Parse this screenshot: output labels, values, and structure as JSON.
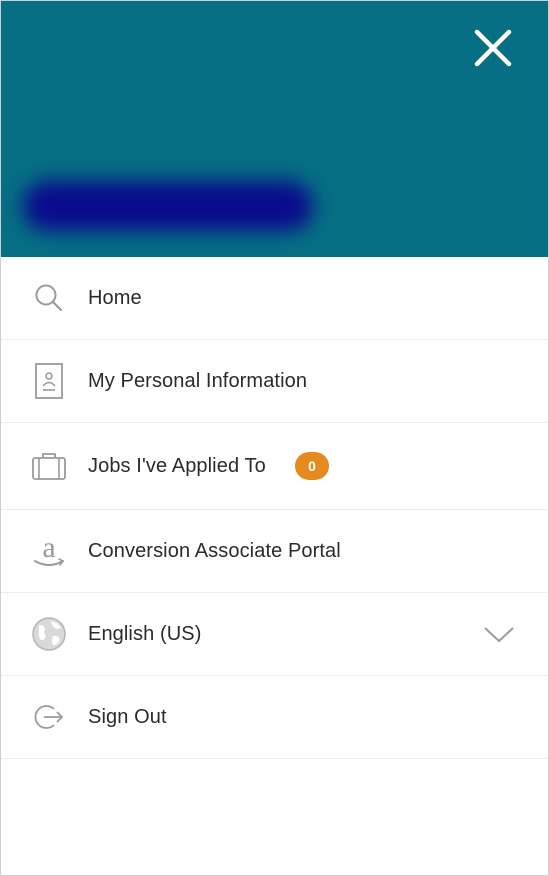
{
  "header": {
    "background_color": "#066f84",
    "close_icon": "close-icon",
    "user_name_redacted": true
  },
  "menu": {
    "items": [
      {
        "label": "Home",
        "icon": "search-icon"
      },
      {
        "label": "My Personal Information",
        "icon": "id-card-icon"
      },
      {
        "label": "Jobs I've Applied To",
        "icon": "briefcase-icon",
        "badge": "0"
      },
      {
        "label": "Conversion Associate Portal",
        "icon": "amazon-icon"
      },
      {
        "label": "English (US)",
        "icon": "globe-icon",
        "dropdown_icon": "chevron-down-icon"
      },
      {
        "label": "Sign Out",
        "icon": "sign-out-icon"
      }
    ]
  },
  "colors": {
    "badge": "#e58a1f",
    "text": "#2b2b2b",
    "icon": "#9a9a9a"
  }
}
